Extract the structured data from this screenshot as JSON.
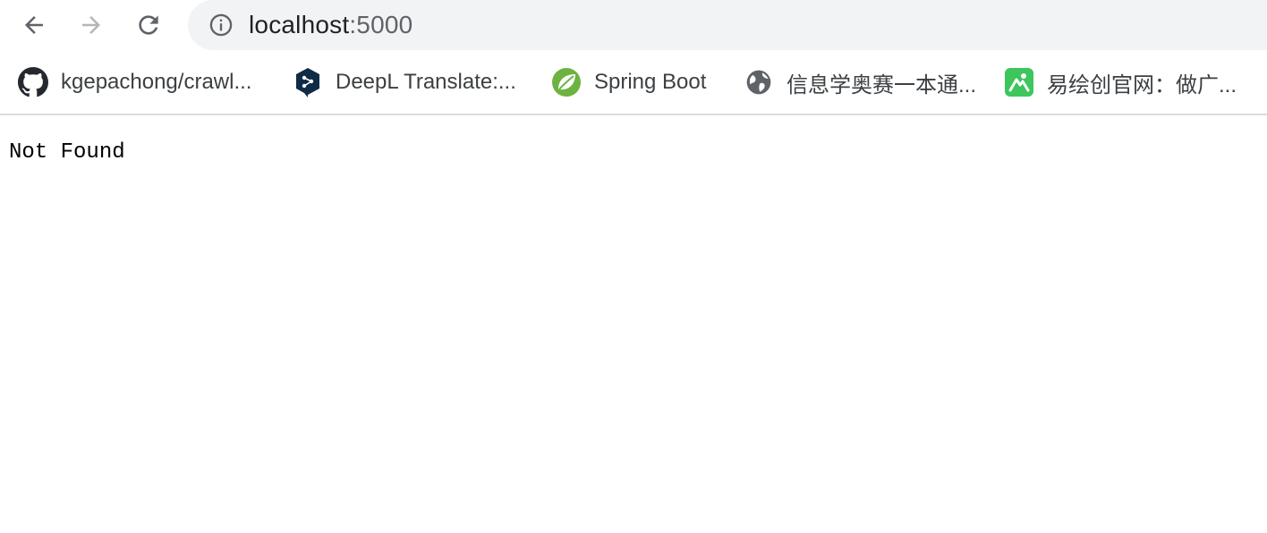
{
  "browser": {
    "address_bar": {
      "host": "localhost",
      "port": ":5000",
      "info_icon": "info-icon"
    },
    "nav": {
      "back_icon": "arrow-left-icon",
      "forward_icon": "arrow-right-icon",
      "reload_icon": "reload-icon"
    },
    "bookmarks": [
      {
        "label": "kgepachong/crawl...",
        "icon": "github-icon"
      },
      {
        "label": "DeepL Translate:...",
        "icon": "deepl-icon"
      },
      {
        "label": "Spring Boot",
        "icon": "spring-leaf-icon"
      },
      {
        "label": "信息学奥赛一本通...",
        "icon": "globe-icon"
      },
      {
        "label": "易绘创官网：做广...",
        "icon": "yihuichuang-icon"
      }
    ],
    "colors": {
      "omnibox_bg": "#f1f3f4",
      "spring_green": "#6db33f",
      "deepl_navy": "#0f2b46",
      "yihui_green": "#3cc65c"
    }
  },
  "page": {
    "message": "Not Found"
  }
}
